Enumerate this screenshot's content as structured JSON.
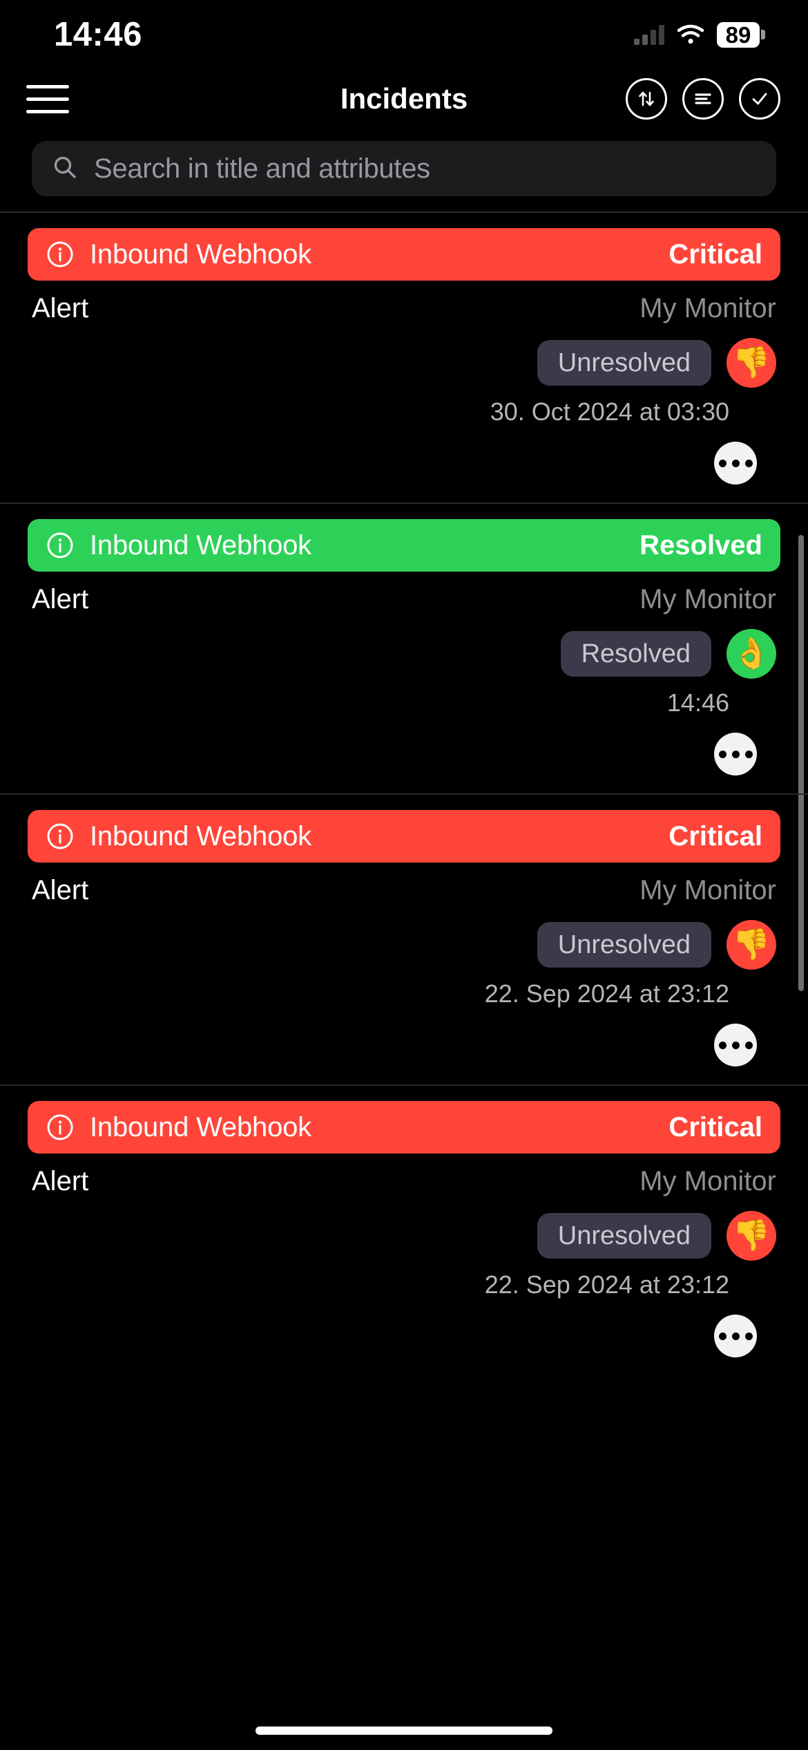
{
  "status_bar": {
    "time": "14:46",
    "battery_percent": "89",
    "signal_icon": "cellular-signal-icon",
    "wifi_icon": "wifi-icon",
    "battery_icon": "battery-icon"
  },
  "nav": {
    "menu_icon": "hamburger-menu-icon",
    "title": "Incidents",
    "actions": [
      {
        "name": "sort-button",
        "icon": "sort-arrows-icon"
      },
      {
        "name": "filter-button",
        "icon": "filter-lines-icon"
      },
      {
        "name": "select-all-button",
        "icon": "checkmark-circle-icon"
      }
    ]
  },
  "search": {
    "icon": "search-icon",
    "value": "",
    "placeholder": "Search in title and attributes"
  },
  "colors": {
    "critical": "#FF453A",
    "resolved": "#2ED158",
    "pill_bg": "#3A3A4A",
    "search_bg": "#1C1C1E",
    "muted_text": "#8E8E93"
  },
  "incidents": [
    {
      "banner_icon": "info-circle-icon",
      "banner_title": "Inbound Webhook",
      "banner_status": "Critical",
      "severity": "critical",
      "type_label": "Alert",
      "monitor": "My Monitor",
      "state_pill": "Unresolved",
      "state_emoji": "👎",
      "state_emoji_name": "thumbs-down-icon",
      "timestamp": "30. Oct 2024 at 03:30",
      "more_icon": "more-options-icon"
    },
    {
      "banner_icon": "info-circle-icon",
      "banner_title": "Inbound Webhook",
      "banner_status": "Resolved",
      "severity": "resolved",
      "type_label": "Alert",
      "monitor": "My Monitor",
      "state_pill": "Resolved",
      "state_emoji": "👌",
      "state_emoji_name": "ok-hand-icon",
      "timestamp": "14:46",
      "more_icon": "more-options-icon"
    },
    {
      "banner_icon": "info-circle-icon",
      "banner_title": "Inbound Webhook",
      "banner_status": "Critical",
      "severity": "critical",
      "type_label": "Alert",
      "monitor": "My Monitor",
      "state_pill": "Unresolved",
      "state_emoji": "👎",
      "state_emoji_name": "thumbs-down-icon",
      "timestamp": "22. Sep 2024 at 23:12",
      "more_icon": "more-options-icon"
    },
    {
      "banner_icon": "info-circle-icon",
      "banner_title": "Inbound Webhook",
      "banner_status": "Critical",
      "severity": "critical",
      "type_label": "Alert",
      "monitor": "My Monitor",
      "state_pill": "Unresolved",
      "state_emoji": "👎",
      "state_emoji_name": "thumbs-down-icon",
      "timestamp": "22. Sep 2024 at 23:12",
      "more_icon": "more-options-icon"
    }
  ]
}
